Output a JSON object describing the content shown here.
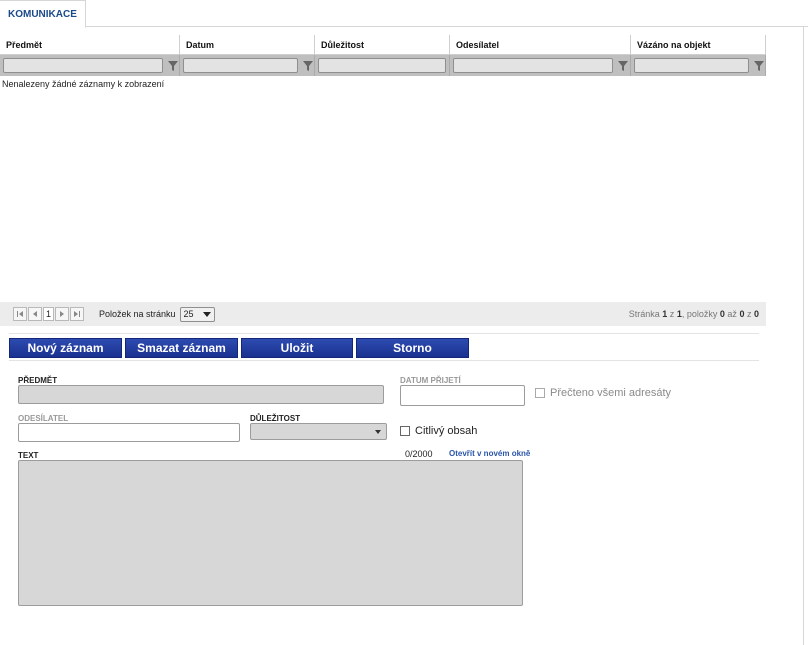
{
  "tab": {
    "label": "KOMUNIKACE"
  },
  "grid": {
    "columns": [
      "Předmět",
      "Datum",
      "Důležitost",
      "Odesílatel",
      "Vázáno na objekt"
    ],
    "empty_message": "Nenalezeny žádné záznamy k zobrazení"
  },
  "pager": {
    "current_page": "1",
    "page_size_label": "Položek na stránku",
    "page_size": "25",
    "info_prefix": "Stránka",
    "info_page": "1",
    "info_of": "z",
    "info_total_pages": "1",
    "info_items": ", položky",
    "info_from": "0",
    "info_to_word": "až",
    "info_to": "0",
    "info_of2": "z",
    "info_count": "0"
  },
  "buttons": {
    "new": "Nový záznam",
    "delete": "Smazat záznam",
    "save": "Uložit",
    "cancel": "Storno"
  },
  "form": {
    "subject_label": "PŘEDMĚT",
    "received_label": "DATUM PŘIJETÍ",
    "read_all_label": "Přečteno všemi adresáty",
    "sender_label": "ODESÍLATEL",
    "importance_label": "DŮLEŽITOST",
    "sensitive_label": "Citlivý obsah",
    "text_label": "TEXT",
    "text_counter": "0/2000",
    "open_new_window": "Otevřít v novém okně"
  },
  "colors": {
    "accent": "#1a4a8a",
    "button": "#1f3a9e"
  }
}
